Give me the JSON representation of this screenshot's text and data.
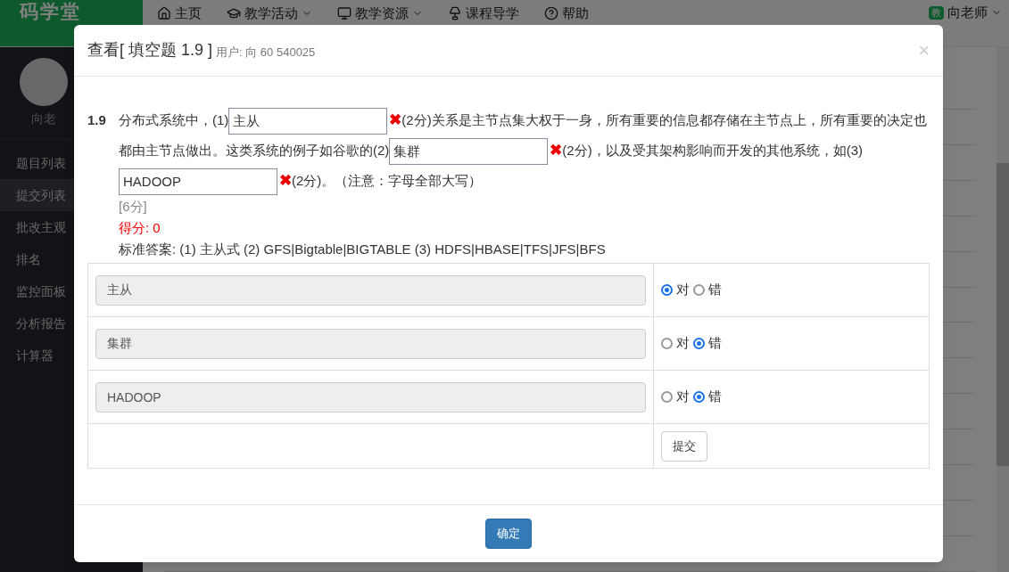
{
  "nav": {
    "logo": "码学堂",
    "items": [
      {
        "label": "主页",
        "dropdown": false
      },
      {
        "label": "教学活动",
        "dropdown": true
      },
      {
        "label": "教学资源",
        "dropdown": true
      },
      {
        "label": "课程导学",
        "dropdown": false
      },
      {
        "label": "帮助",
        "dropdown": false
      }
    ],
    "user": {
      "badge": "教",
      "name": "向老师",
      "dropdown": true
    }
  },
  "sidebar": {
    "user_name": "向老",
    "items": [
      {
        "label": "题目列表",
        "selected": false
      },
      {
        "label": "提交列表",
        "selected": true
      },
      {
        "label": "批改主观",
        "selected": false
      },
      {
        "label": "排名",
        "selected": false
      },
      {
        "label": "监控面板",
        "selected": false
      },
      {
        "label": "分析报告",
        "selected": false
      },
      {
        "label": "计算器",
        "selected": false
      }
    ]
  },
  "dialog": {
    "title": "查看[ 填空题 1.9 ]",
    "user": "用户: 向 60 540025",
    "close": "×",
    "question": {
      "number": "1.9",
      "parts": [
        {
          "kind": "text",
          "text": "分布式系统中，(1)"
        },
        {
          "kind": "blank",
          "value": "主从",
          "correct": false,
          "mark": "✖"
        },
        {
          "kind": "text",
          "text": "(2分)关系是主节点集大权于一身，所有重要的信息都存储在主节点上，所有重要的决定也都由主节点做出。这类系统的例子如谷歌的(2)"
        },
        {
          "kind": "blank",
          "value": "集群",
          "correct": false,
          "mark": "✖"
        },
        {
          "kind": "text",
          "text": "(2分)，以及受其架构影响而开发的其他系统，如(3)"
        },
        {
          "kind": "blank",
          "value": "HADOOP",
          "correct": false,
          "mark": "✖"
        },
        {
          "kind": "text",
          "text": "(2分)。（注意：字母全部大写）"
        }
      ],
      "points": "[6分]",
      "score": "得分: 0",
      "standard_answer": "标准答案: (1) 主从式 (2) GFS|Bigtable|BIGTABLE (3) HDFS|HBASE|TFS|JFS|BFS"
    },
    "grading": [
      {
        "answer": "主从",
        "options": [
          {
            "label": "对",
            "selected": true
          },
          {
            "label": "错",
            "selected": false
          }
        ]
      },
      {
        "answer": "集群",
        "options": [
          {
            "label": "对",
            "selected": false
          },
          {
            "label": "错",
            "selected": true
          }
        ]
      },
      {
        "answer": "HADOOP",
        "options": [
          {
            "label": "对",
            "selected": false
          },
          {
            "label": "错",
            "selected": true
          }
        ]
      }
    ],
    "submit": "提交",
    "confirm": "确定"
  }
}
